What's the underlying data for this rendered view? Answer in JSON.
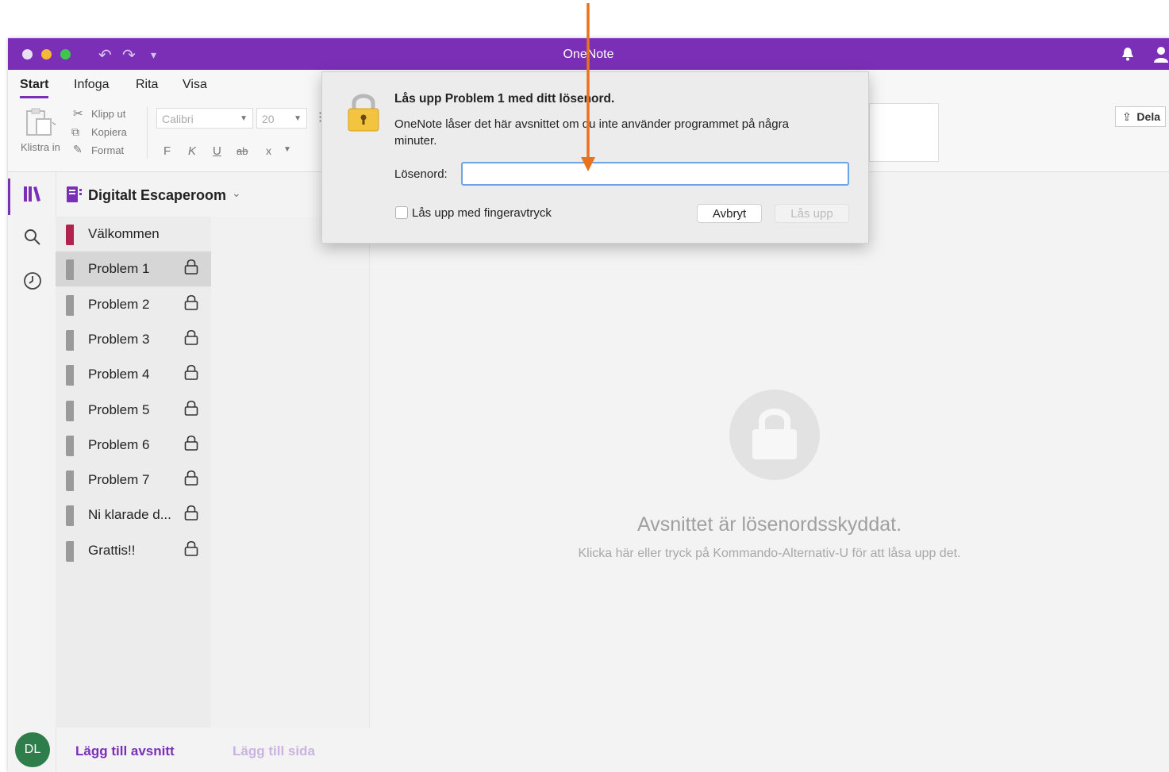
{
  "window": {
    "title": "OneNote"
  },
  "ribbon": {
    "tabs": [
      "Start",
      "Infoga",
      "Rita",
      "Visa"
    ],
    "paste_label": "Klistra in",
    "cut_label": "Klipp ut",
    "copy_label": "Kopiera",
    "format_label": "Format",
    "font_name": "Calibri",
    "font_size": "20",
    "bold": "F",
    "italic": "K",
    "underline": "U",
    "strike": "ab",
    "subscript": "x",
    "share_label": "Dela"
  },
  "notebook": {
    "name": "Digitalt Escaperoom",
    "sections": [
      {
        "label": "Välkommen",
        "locked": false,
        "color": "#b0234e"
      },
      {
        "label": "Problem 1",
        "locked": true,
        "color": "#9a9a9a"
      },
      {
        "label": "Problem 2",
        "locked": true,
        "color": "#9a9a9a"
      },
      {
        "label": "Problem 3",
        "locked": true,
        "color": "#9a9a9a"
      },
      {
        "label": "Problem 4",
        "locked": true,
        "color": "#9a9a9a"
      },
      {
        "label": "Problem 5",
        "locked": true,
        "color": "#9a9a9a"
      },
      {
        "label": "Problem 6",
        "locked": true,
        "color": "#9a9a9a"
      },
      {
        "label": "Problem 7",
        "locked": true,
        "color": "#9a9a9a"
      },
      {
        "label": "Ni klarade d...",
        "locked": true,
        "color": "#9a9a9a"
      },
      {
        "label": "Grattis!!",
        "locked": true,
        "color": "#9a9a9a"
      }
    ],
    "selected_section": "Problem 1"
  },
  "footer": {
    "avatar": "DL",
    "add_section": "Lägg till avsnitt",
    "add_page": "Lägg till sida"
  },
  "content": {
    "locked_title": "Avsnittet är lösenordsskyddat.",
    "locked_hint": "Klicka här eller tryck på Kommando-Alternativ-U för att låsa upp det."
  },
  "dialog": {
    "title": "Lås upp Problem 1 med ditt lösenord.",
    "message": "OneNote låser det här avsnittet om du inte använder programmet på några minuter.",
    "password_label": "Lösenord:",
    "password_value": "",
    "fingerprint_label": "Lås upp med fingeravtryck",
    "fingerprint_checked": false,
    "cancel_label": "Avbryt",
    "unlock_label": "Lås upp"
  },
  "colors": {
    "brand": "#7b2fb7",
    "annotation_arrow": "#e8731f",
    "avatar_bg": "#2e7d4a"
  }
}
